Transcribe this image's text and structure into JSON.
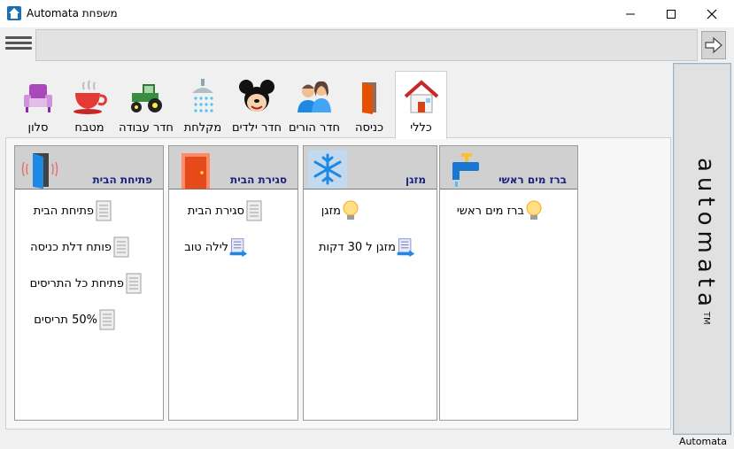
{
  "window": {
    "title": "Automata משפחת",
    "controls": [
      "minimize-icon",
      "maximize-icon",
      "close-icon"
    ]
  },
  "toolbar": {
    "address_value": "",
    "menu_icon": "hamburger-icon",
    "go_icon": "arrow-right-icon"
  },
  "tabs": [
    {
      "label": "כללי",
      "icon": "house-icon",
      "active": true
    },
    {
      "label": "כניסה",
      "icon": "door-icon",
      "active": false
    },
    {
      "label": "חדר הורים",
      "icon": "couple-icon",
      "active": false
    },
    {
      "label": "חדר ילדים",
      "icon": "mouse-character-icon",
      "active": false
    },
    {
      "label": "מקלחת",
      "icon": "shower-icon",
      "active": false
    },
    {
      "label": "חדר עבודה",
      "icon": "tractor-icon",
      "active": false
    },
    {
      "label": "מטבח",
      "icon": "cup-icon",
      "active": false
    },
    {
      "label": "סלון",
      "icon": "armchair-icon",
      "active": false
    }
  ],
  "panels": [
    {
      "title": "ברז מים ראשי",
      "icon": "faucet-icon",
      "items": [
        {
          "label": "ברז מים ראשי",
          "icon": "lightbulb-icon"
        }
      ]
    },
    {
      "title": "מזגן",
      "icon": "snowflake-icon",
      "items": [
        {
          "label": "מזגן",
          "icon": "lightbulb-icon"
        },
        {
          "label": "מזגן ל 30 דקות",
          "icon": "scroll-arrow-icon"
        }
      ]
    },
    {
      "title": "סגירת הבית",
      "icon": "closed-door-icon",
      "items": [
        {
          "label": "סגירת הבית",
          "icon": "scroll-icon"
        },
        {
          "label": "לילה טוב",
          "icon": "scroll-arrow-icon"
        }
      ]
    },
    {
      "title": "פתיחת הבית",
      "icon": "open-door-icon",
      "items": [
        {
          "label": "פתיחת הבית",
          "icon": "scroll-icon"
        },
        {
          "label": "פותח דלת כניסה",
          "icon": "scroll-icon"
        },
        {
          "label": "פתיחת כל התריסים",
          "icon": "scroll-icon"
        },
        {
          "label": "50% תריסים",
          "icon": "scroll-icon"
        }
      ]
    }
  ],
  "brand": {
    "text": "automata",
    "trademark": "TM"
  },
  "statusbar": {
    "text": "Automata"
  }
}
